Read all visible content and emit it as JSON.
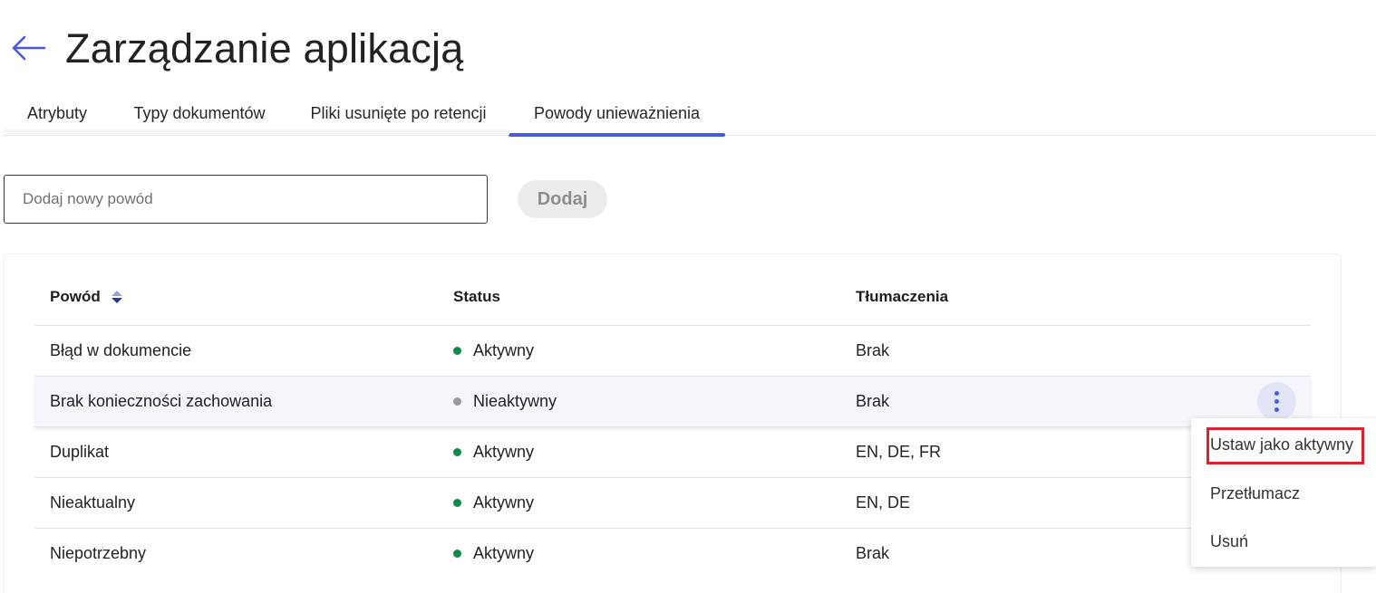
{
  "header": {
    "title": "Zarządzanie aplikacją"
  },
  "tabs": [
    {
      "label": "Atrybuty",
      "active": false
    },
    {
      "label": "Typy dokumentów",
      "active": false
    },
    {
      "label": "Pliki usunięte po retencji",
      "active": false
    },
    {
      "label": "Powody unieważnienia",
      "active": true
    }
  ],
  "add_form": {
    "placeholder": "Dodaj nowy powód",
    "value": "",
    "button_label": "Dodaj",
    "button_disabled": true
  },
  "table": {
    "columns": [
      {
        "label": "Powód",
        "sortable": true,
        "sort": "descending"
      },
      {
        "label": "Status"
      },
      {
        "label": "Tłumaczenia"
      }
    ],
    "rows": [
      {
        "reason": "Błąd w dokumencie",
        "status": "Aktywny",
        "status_color": "#12894a",
        "translations": "Brak"
      },
      {
        "reason": "Brak konieczności zachowania",
        "status": "Nieaktywny",
        "status_color": "#9a9a9a",
        "translations": "Brak",
        "highlighted": true
      },
      {
        "reason": "Duplikat",
        "status": "Aktywny",
        "status_color": "#12894a",
        "translations": "EN, DE, FR"
      },
      {
        "reason": "Nieaktualny",
        "status": "Aktywny",
        "status_color": "#12894a",
        "translations": "EN, DE"
      },
      {
        "reason": "Niepotrzebny",
        "status": "Aktywny",
        "status_color": "#12894a",
        "translations": "Brak"
      }
    ]
  },
  "context_menu": {
    "items": [
      {
        "label": "Ustaw jako aktywny",
        "emphasized": true
      },
      {
        "label": "Przetłumacz"
      },
      {
        "label": "Usuń"
      }
    ]
  },
  "colors": {
    "accent": "#4a5bd4",
    "active_status": "#12894a",
    "inactive_status": "#9a9a9a",
    "emphasis_outline": "#d8232f"
  },
  "icons": {
    "back": "arrow-left-icon",
    "sort": "sort-icon",
    "row_actions": "kebab-menu-icon"
  }
}
